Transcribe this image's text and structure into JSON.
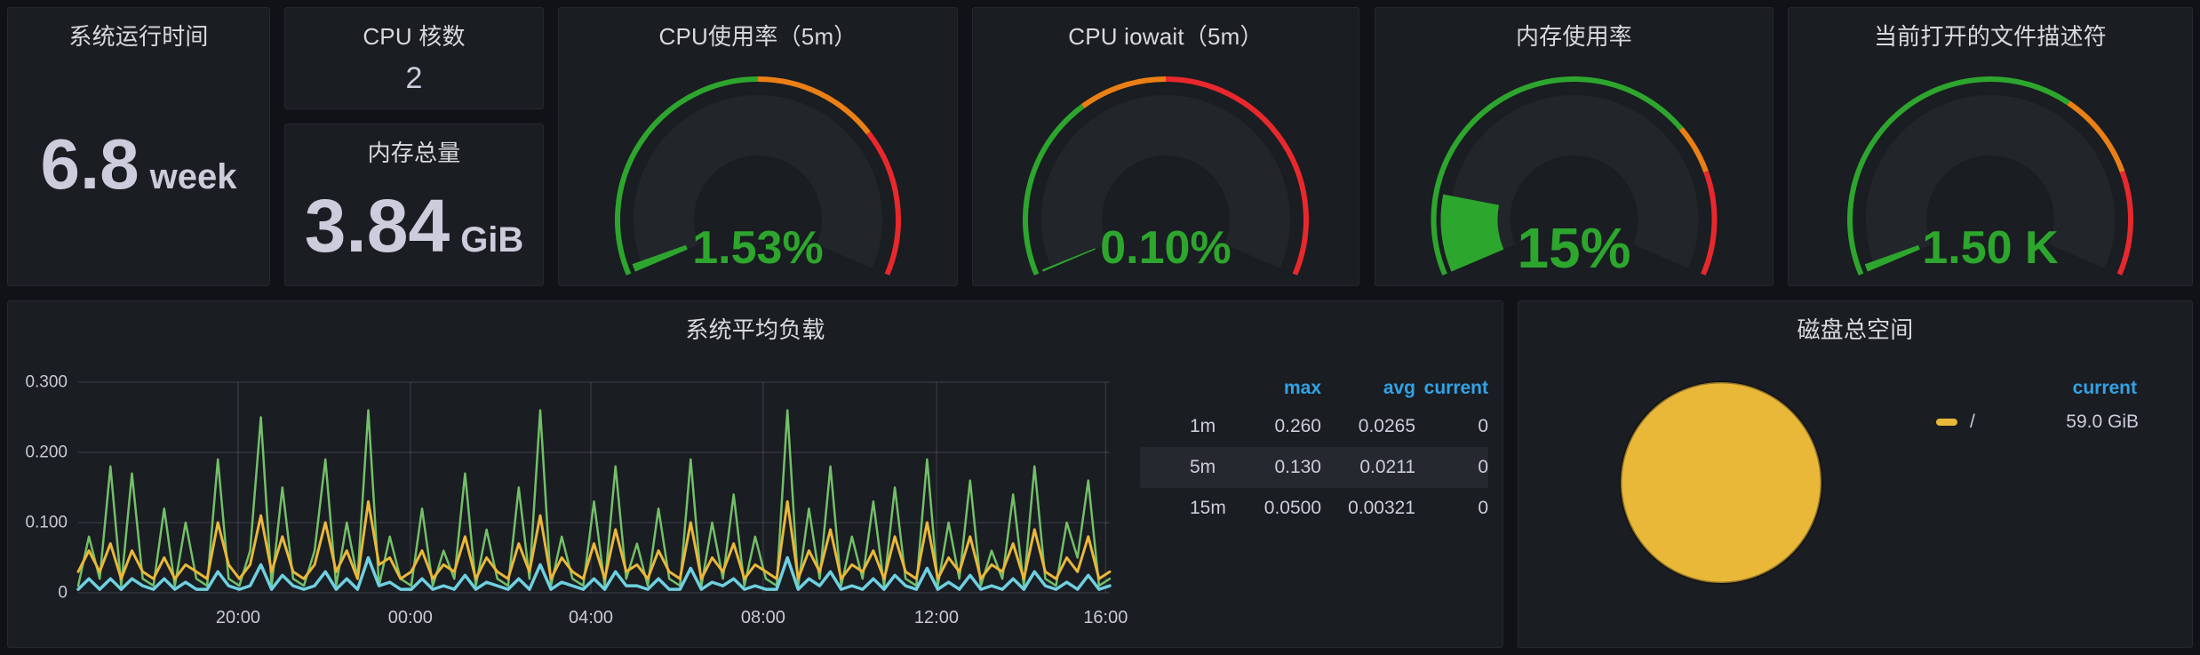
{
  "colors": {
    "page_bg": "#111217",
    "panel_bg": "#1a1d22",
    "panel_border": "#24282e",
    "text": "#ccccdc",
    "title": "#d8d9da",
    "gauge_green": "#2da62d",
    "gauge_orange": "#ea8015",
    "gauge_red": "#e8282c",
    "gauge_face": "#22262b",
    "legend_header_blue": "#33a2e5",
    "grid": "rgba(204,204,220,0.14)",
    "axis_text": "#c8c9d4"
  },
  "stats": {
    "uptime": {
      "title": "系统运行时间",
      "value": "6.8",
      "unit": "week"
    },
    "cpu_cores": {
      "title": "CPU 核数",
      "value": "2"
    },
    "mem_total": {
      "title": "内存总量",
      "value": "3.84",
      "unit": "GiB"
    }
  },
  "gauges": [
    {
      "title": "CPU使用率（5m）",
      "value_text": "1.53%",
      "value_fraction": 0.0153,
      "font": 52,
      "segments": [
        {
          "to": 0.5,
          "color": "green"
        },
        {
          "to": 0.73,
          "color": "orange"
        },
        {
          "to": 1,
          "color": "red"
        }
      ]
    },
    {
      "title": "CPU iowait（5m）",
      "value_text": "0.10%",
      "value_fraction": 0.001,
      "font": 52,
      "segments": [
        {
          "to": 0.34,
          "color": "green"
        },
        {
          "to": 0.5,
          "color": "orange"
        },
        {
          "to": 1,
          "color": "red"
        }
      ]
    },
    {
      "title": "内存使用率",
      "value_text": "15%",
      "value_fraction": 0.15,
      "font": 64,
      "segments": [
        {
          "to": 0.72,
          "color": "green"
        },
        {
          "to": 0.81,
          "color": "orange"
        },
        {
          "to": 1,
          "color": "red"
        }
      ]
    },
    {
      "title": "当前打开的文件描述符",
      "value_text": "1.50 K",
      "value_fraction": 0.015,
      "font": 52,
      "segments": [
        {
          "to": 0.65,
          "color": "green"
        },
        {
          "to": 0.81,
          "color": "orange"
        },
        {
          "to": 1,
          "color": "red"
        }
      ]
    }
  ],
  "chart_data": [
    {
      "type": "line",
      "title": "系统平均负载",
      "x_tick_labels": [
        "20:00",
        "00:00",
        "04:00",
        "08:00",
        "12:00",
        "16:00"
      ],
      "x_tick_fractions": [
        0.155,
        0.322,
        0.497,
        0.664,
        0.832,
        0.996
      ],
      "y_tick_labels": [
        "0",
        "0.100",
        "0.200",
        "0.300"
      ],
      "y_tick_values": [
        0,
        0.1,
        0.2,
        0.3
      ],
      "ylim": [
        0,
        0.318
      ],
      "grid": true,
      "legend": {
        "position": "right",
        "columns": [
          "max",
          "avg",
          "current"
        ],
        "highlighted_series": "5m"
      },
      "series": [
        {
          "name": "1m",
          "color": "#73BF69",
          "width": 2.5,
          "max": "0.260",
          "avg": "0.0265",
          "current": "0",
          "values": [
            0.01,
            0.08,
            0.02,
            0.18,
            0.01,
            0.17,
            0.02,
            0.01,
            0.12,
            0.01,
            0.1,
            0.02,
            0.01,
            0.19,
            0.02,
            0.01,
            0.06,
            0.25,
            0.01,
            0.15,
            0.02,
            0.01,
            0.06,
            0.19,
            0.01,
            0.1,
            0.02,
            0.26,
            0.01,
            0.08,
            0.02,
            0.01,
            0.12,
            0.01,
            0.06,
            0.02,
            0.17,
            0.01,
            0.09,
            0.02,
            0.01,
            0.15,
            0.02,
            0.26,
            0.01,
            0.08,
            0.02,
            0.01,
            0.13,
            0.01,
            0.18,
            0.02,
            0.07,
            0.01,
            0.12,
            0.02,
            0.01,
            0.19,
            0.01,
            0.1,
            0.02,
            0.14,
            0.01,
            0.08,
            0.02,
            0.01,
            0.26,
            0.01,
            0.12,
            0.02,
            0.18,
            0.01,
            0.08,
            0.02,
            0.13,
            0.01,
            0.15,
            0.02,
            0.01,
            0.19,
            0.01,
            0.1,
            0.02,
            0.16,
            0.01,
            0.06,
            0.02,
            0.14,
            0.01,
            0.18,
            0.02,
            0.01,
            0.1,
            0.05,
            0.16,
            0.01,
            0.02
          ]
        },
        {
          "name": "5m",
          "color": "#EAB839",
          "width": 3,
          "max": "0.130",
          "avg": "0.0211",
          "current": "0",
          "values": [
            0.03,
            0.06,
            0.03,
            0.07,
            0.02,
            0.06,
            0.03,
            0.02,
            0.05,
            0.02,
            0.04,
            0.03,
            0.02,
            0.1,
            0.04,
            0.02,
            0.04,
            0.11,
            0.03,
            0.08,
            0.03,
            0.02,
            0.04,
            0.1,
            0.03,
            0.06,
            0.02,
            0.13,
            0.04,
            0.05,
            0.02,
            0.03,
            0.06,
            0.02,
            0.04,
            0.03,
            0.08,
            0.02,
            0.05,
            0.03,
            0.02,
            0.07,
            0.03,
            0.11,
            0.02,
            0.05,
            0.03,
            0.02,
            0.07,
            0.02,
            0.09,
            0.03,
            0.04,
            0.02,
            0.06,
            0.03,
            0.02,
            0.1,
            0.02,
            0.05,
            0.03,
            0.07,
            0.02,
            0.04,
            0.03,
            0.02,
            0.13,
            0.02,
            0.06,
            0.03,
            0.09,
            0.02,
            0.04,
            0.03,
            0.06,
            0.02,
            0.08,
            0.03,
            0.02,
            0.1,
            0.02,
            0.05,
            0.03,
            0.08,
            0.02,
            0.04,
            0.03,
            0.07,
            0.02,
            0.09,
            0.03,
            0.02,
            0.05,
            0.03,
            0.08,
            0.02,
            0.03
          ]
        },
        {
          "name": "15m",
          "color": "#6ED0E0",
          "width": 3.5,
          "max": "0.0500",
          "avg": "0.00321",
          "current": "0",
          "values": [
            0.005,
            0.02,
            0.005,
            0.02,
            0.005,
            0.02,
            0.01,
            0.005,
            0.02,
            0.005,
            0.015,
            0.005,
            0.005,
            0.03,
            0.01,
            0.005,
            0.01,
            0.04,
            0.005,
            0.025,
            0.01,
            0.005,
            0.01,
            0.03,
            0.005,
            0.02,
            0.005,
            0.05,
            0.01,
            0.015,
            0.005,
            0.005,
            0.02,
            0.005,
            0.01,
            0.005,
            0.025,
            0.005,
            0.015,
            0.01,
            0.005,
            0.02,
            0.005,
            0.04,
            0.005,
            0.015,
            0.01,
            0.005,
            0.02,
            0.005,
            0.03,
            0.01,
            0.01,
            0.005,
            0.02,
            0.005,
            0.005,
            0.035,
            0.005,
            0.015,
            0.01,
            0.02,
            0.005,
            0.01,
            0.005,
            0.005,
            0.05,
            0.005,
            0.02,
            0.01,
            0.03,
            0.005,
            0.01,
            0.005,
            0.02,
            0.005,
            0.025,
            0.01,
            0.005,
            0.035,
            0.005,
            0.015,
            0.005,
            0.025,
            0.005,
            0.01,
            0.005,
            0.02,
            0.005,
            0.03,
            0.01,
            0.005,
            0.015,
            0.005,
            0.025,
            0.005,
            0.01
          ]
        }
      ]
    },
    {
      "type": "pie",
      "title": "磁盘总空间",
      "legend": {
        "position": "right",
        "columns": [
          "current"
        ]
      },
      "slices": [
        {
          "label": "/",
          "value": "59.0 GiB",
          "fraction": 1,
          "color": "#EAB839"
        }
      ]
    }
  ]
}
